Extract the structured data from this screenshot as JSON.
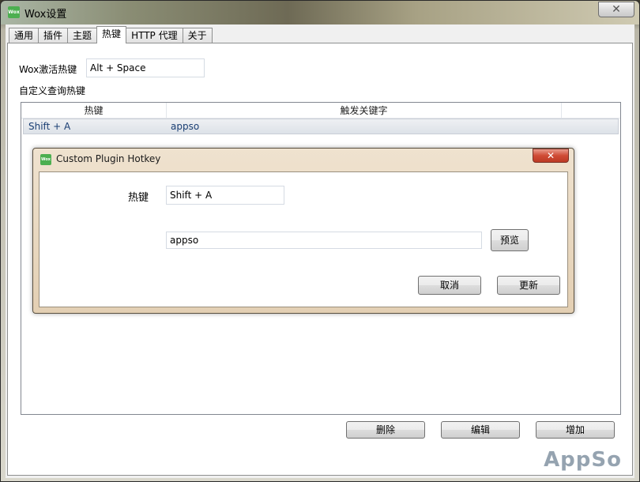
{
  "window": {
    "title": "Wox设置",
    "icon_text": "Wox",
    "close_glyph": "✕"
  },
  "tabs": [
    {
      "label": "通用"
    },
    {
      "label": "插件"
    },
    {
      "label": "主题"
    },
    {
      "label": "热键",
      "active": true
    },
    {
      "label": "HTTP 代理"
    },
    {
      "label": "关于"
    }
  ],
  "hotkey": {
    "activate_label": "Wox激活热键",
    "activate_value": "Alt + Space",
    "custom_label": "自定义查询热键"
  },
  "table": {
    "columns": [
      "热键",
      "触发关键字"
    ],
    "rows": [
      {
        "hotkey": "Shift + A",
        "keyword": "appso"
      }
    ]
  },
  "actions": {
    "delete": "删除",
    "edit": "编辑",
    "add": "增加"
  },
  "dialog": {
    "title": "Custom Plugin Hotkey",
    "icon_text": "Wox",
    "close_glyph": "✕",
    "hotkey_label": "热键",
    "hotkey_value": "Shift + A",
    "keyword_value": "appso",
    "preview_label": "预览",
    "cancel_label": "取消",
    "update_label": "更新"
  },
  "watermark": "AppSo",
  "colors": {
    "selected_row_text": "#1a3e73",
    "dialog_close": "#cf4b35",
    "app_icon": "#4caf50"
  }
}
